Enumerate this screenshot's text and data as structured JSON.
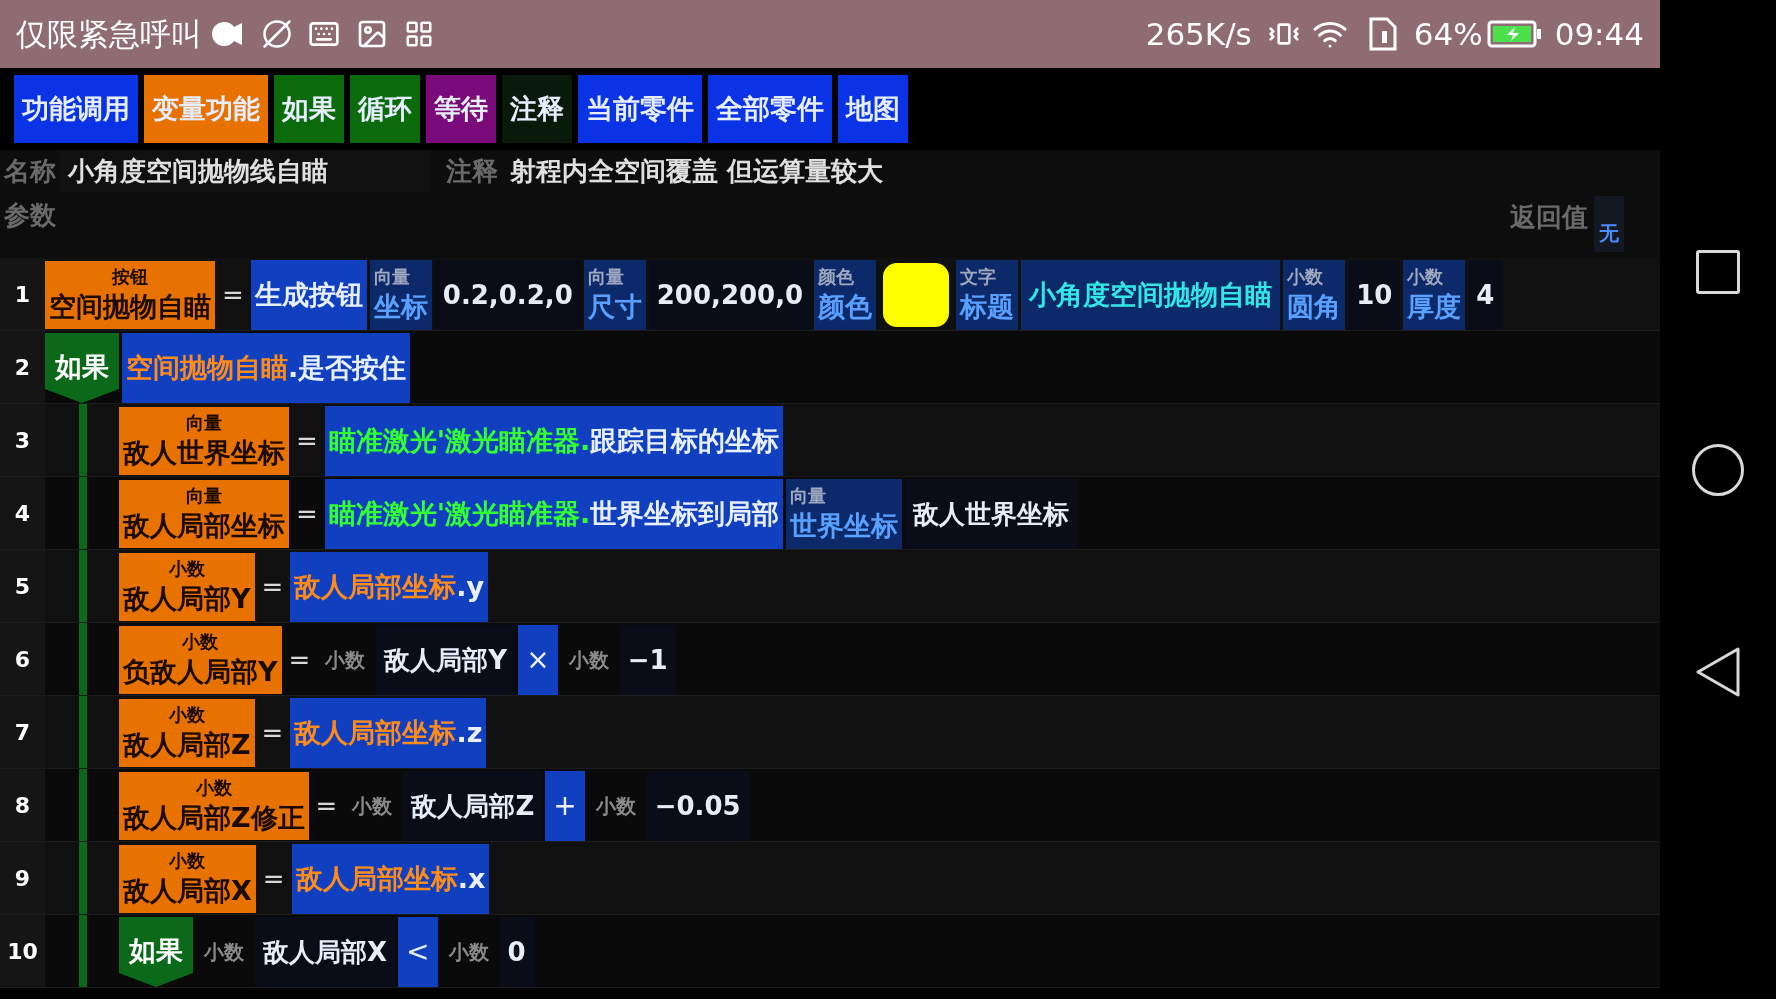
{
  "status_bar": {
    "carrier_text": "仅限紧急呼叫",
    "speed": "265K/s",
    "battery_percent": "64%",
    "time": "09:44"
  },
  "toolbar": [
    {
      "label": "功能调用",
      "color": "#0a33e6"
    },
    {
      "label": "变量功能",
      "color": "#e87200"
    },
    {
      "label": "如果",
      "color": "#0b6a0b"
    },
    {
      "label": "循环",
      "color": "#0b6a0b"
    },
    {
      "label": "等待",
      "color": "#7a0a7a"
    },
    {
      "label": "注释",
      "color": "#0a1a0a"
    },
    {
      "label": "当前零件",
      "color": "#0a33e6"
    },
    {
      "label": "全部零件",
      "color": "#0a33e6"
    },
    {
      "label": "地图",
      "color": "#0a33e6"
    }
  ],
  "header": {
    "name_label": "名称",
    "name": "小角度空间抛物线自瞄",
    "note_label": "注释",
    "note": "射程内全空间覆盖 但运算量较大",
    "params_label": "参数",
    "return_label": "返回值",
    "return_value": "无"
  },
  "lines": [
    {
      "number": "1",
      "tokens": [
        {
          "kind": "var",
          "type": "按钮",
          "name": "空间抛物自瞄"
        },
        {
          "kind": "assign",
          "text": "="
        },
        {
          "kind": "call",
          "segments": [
            {
              "text": "生成按钮",
              "color": "#e8f0ff"
            }
          ]
        },
        {
          "kind": "param",
          "type": "向量",
          "label": "坐标"
        },
        {
          "kind": "value",
          "text": "0.2,0.2,0"
        },
        {
          "kind": "param",
          "type": "向量",
          "label": "尺寸"
        },
        {
          "kind": "value",
          "text": "200,200,0"
        },
        {
          "kind": "param",
          "type": "颜色",
          "label": "颜色"
        },
        {
          "kind": "swatch",
          "color": "#ffff00"
        },
        {
          "kind": "param",
          "type": "文字",
          "label": "标题"
        },
        {
          "kind": "text",
          "text": "小角度空间抛物自瞄"
        },
        {
          "kind": "param",
          "type": "小数",
          "label": "圆角"
        },
        {
          "kind": "value",
          "text": "10"
        },
        {
          "kind": "param",
          "type": "小数",
          "label": "厚度"
        },
        {
          "kind": "value",
          "text": "4"
        }
      ]
    },
    {
      "number": "2",
      "tokens": [
        {
          "kind": "keyword",
          "text": "如果"
        },
        {
          "kind": "call",
          "segments": [
            {
              "text": "空间抛物自瞄",
              "color": "#ff8c1a"
            },
            {
              "text": ".是否按住",
              "color": "#e8f0ff"
            }
          ]
        }
      ],
      "children": [
        {
          "number": "3",
          "tokens": [
            {
              "kind": "var",
              "type": "向量",
              "name": "敌人世界坐标"
            },
            {
              "kind": "assign",
              "text": "="
            },
            {
              "kind": "call",
              "segments": [
                {
                  "text": "瞄准激光'激光瞄准器.",
                  "color": "#33ff33"
                },
                {
                  "text": "跟踪目标的坐标",
                  "color": "#e8f0ff"
                }
              ]
            }
          ]
        },
        {
          "number": "4",
          "tokens": [
            {
              "kind": "var",
              "type": "向量",
              "name": "敌人局部坐标"
            },
            {
              "kind": "assign",
              "text": "="
            },
            {
              "kind": "call",
              "segments": [
                {
                  "text": "瞄准激光'激光瞄准器.",
                  "color": "#33ff33"
                },
                {
                  "text": "世界坐标到局部",
                  "color": "#e8f0ff"
                }
              ]
            },
            {
              "kind": "param",
              "type": "向量",
              "label": "世界坐标"
            },
            {
              "kind": "value",
              "text": "敌人世界坐标"
            }
          ]
        },
        {
          "number": "5",
          "tokens": [
            {
              "kind": "var",
              "type": "小数",
              "name": "敌人局部Y"
            },
            {
              "kind": "assign",
              "text": "="
            },
            {
              "kind": "call",
              "segments": [
                {
                  "text": "敌人局部坐标",
                  "color": "#ff8c1a"
                },
                {
                  "text": ".y",
                  "color": "#e8f0ff"
                }
              ]
            }
          ]
        },
        {
          "number": "6",
          "tokens": [
            {
              "kind": "var",
              "type": "小数",
              "name": "负敌人局部Y"
            },
            {
              "kind": "assign",
              "text": "="
            },
            {
              "kind": "hint",
              "text": "小数"
            },
            {
              "kind": "value",
              "text": "敌人局部Y"
            },
            {
              "kind": "operator",
              "text": "×"
            },
            {
              "kind": "hint",
              "text": "小数"
            },
            {
              "kind": "value",
              "text": "−1"
            }
          ]
        },
        {
          "number": "7",
          "tokens": [
            {
              "kind": "var",
              "type": "小数",
              "name": "敌人局部Z"
            },
            {
              "kind": "assign",
              "text": "="
            },
            {
              "kind": "call",
              "segments": [
                {
                  "text": "敌人局部坐标",
                  "color": "#ff8c1a"
                },
                {
                  "text": ".z",
                  "color": "#e8f0ff"
                }
              ]
            }
          ]
        },
        {
          "number": "8",
          "tokens": [
            {
              "kind": "var",
              "type": "小数",
              "name": "敌人局部Z修正"
            },
            {
              "kind": "assign",
              "text": "="
            },
            {
              "kind": "hint",
              "text": "小数"
            },
            {
              "kind": "value",
              "text": "敌人局部Z"
            },
            {
              "kind": "operator",
              "text": "+"
            },
            {
              "kind": "hint",
              "text": "小数"
            },
            {
              "kind": "value",
              "text": "−0.05"
            }
          ]
        },
        {
          "number": "9",
          "tokens": [
            {
              "kind": "var",
              "type": "小数",
              "name": "敌人局部X"
            },
            {
              "kind": "assign",
              "text": "="
            },
            {
              "kind": "call",
              "segments": [
                {
                  "text": "敌人局部坐标",
                  "color": "#ff8c1a"
                },
                {
                  "text": ".x",
                  "color": "#e8f0ff"
                }
              ]
            }
          ]
        },
        {
          "number": "10",
          "tokens": [
            {
              "kind": "keyword",
              "text": "如果"
            },
            {
              "kind": "hint",
              "text": "小数"
            },
            {
              "kind": "value",
              "text": "敌人局部X"
            },
            {
              "kind": "operator",
              "text": "<"
            },
            {
              "kind": "hint",
              "text": "小数"
            },
            {
              "kind": "value",
              "text": "0"
            }
          ]
        }
      ]
    }
  ]
}
